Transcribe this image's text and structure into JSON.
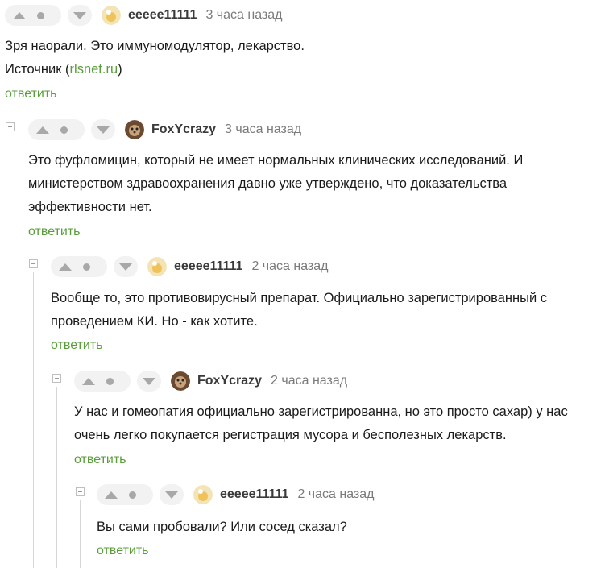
{
  "comments": [
    {
      "author": "eeeee11111",
      "time": "3 часа назад",
      "lines": [
        "Зря наорали. Это иммуномодулятор, лекарство."
      ],
      "source_prefix": "Источник (",
      "source_link": "rlsnet.ru",
      "source_suffix": ")",
      "reply": "ответить",
      "avatar": "avatar-beige"
    },
    {
      "author": "FoxYcrazy",
      "time": "3 часа назад",
      "lines": [
        "Это фуфломицин, который не имеет нормальных клинических исследований. И",
        "министерством здравоохранения давно уже утверждено, что доказательства",
        "эффективности нет."
      ],
      "reply": "ответить",
      "avatar": "avatar-dog"
    },
    {
      "author": "eeeee11111",
      "time": "2 часа назад",
      "lines": [
        "Вообще то, это противовирусный препарат. Официально зарегистрированный с",
        "проведением КИ. Но - как хотите."
      ],
      "reply": "ответить",
      "avatar": "avatar-beige"
    },
    {
      "author": "FoxYcrazy",
      "time": "2 часа назад",
      "lines": [
        "У нас и гомеопатия официально зарегистрированна, но это просто сахар) у нас",
        "очень легко покупается регистрация мусора и бесполезных лекарств."
      ],
      "reply": "ответить",
      "avatar": "avatar-dog"
    },
    {
      "author": "eeeee11111",
      "time": "2 часа назад",
      "lines": [
        "Вы сами пробовали? Или сосед сказал?"
      ],
      "reply": "ответить",
      "avatar": "avatar-beige"
    }
  ],
  "colors": {
    "link_green": "#5a9e3b",
    "pill_bg": "#f2f2f2",
    "icon_gray": "#a8a8a8",
    "thread_line": "#d6d6d6"
  },
  "icons": [
    "vote-up-icon",
    "vote-dot-icon",
    "vote-down-icon",
    "collapse-icon"
  ]
}
